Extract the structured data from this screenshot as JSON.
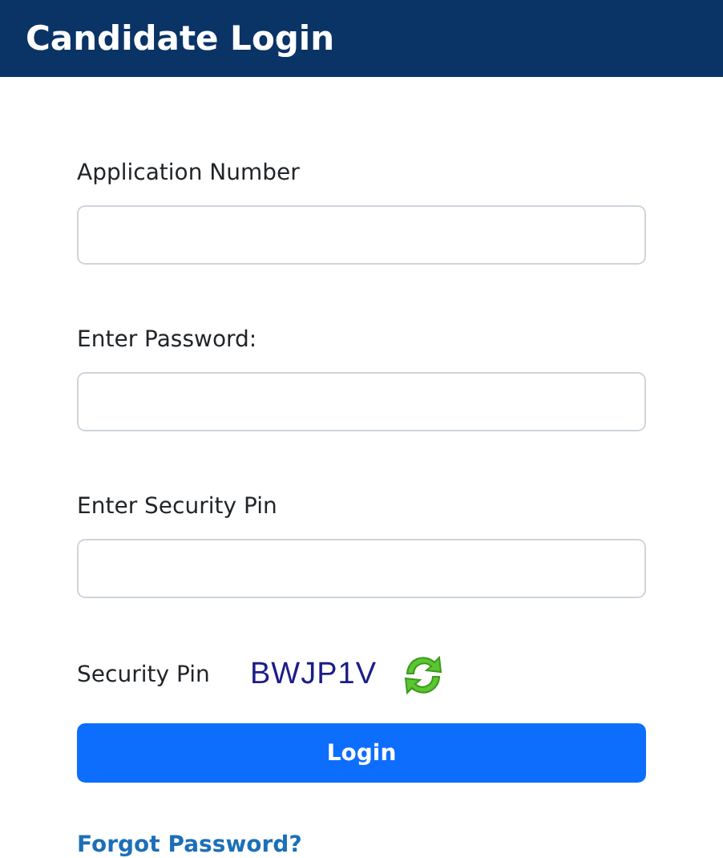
{
  "header": {
    "title": "Candidate Login"
  },
  "fields": [
    {
      "label": "Application Number"
    },
    {
      "label": "Enter Password:"
    },
    {
      "label": "Enter Security Pin"
    }
  ],
  "captcha": {
    "label": "Security Pin",
    "code": "BWJP1V"
  },
  "login_button": "Login",
  "forgot_link": "Forgot Password?"
}
